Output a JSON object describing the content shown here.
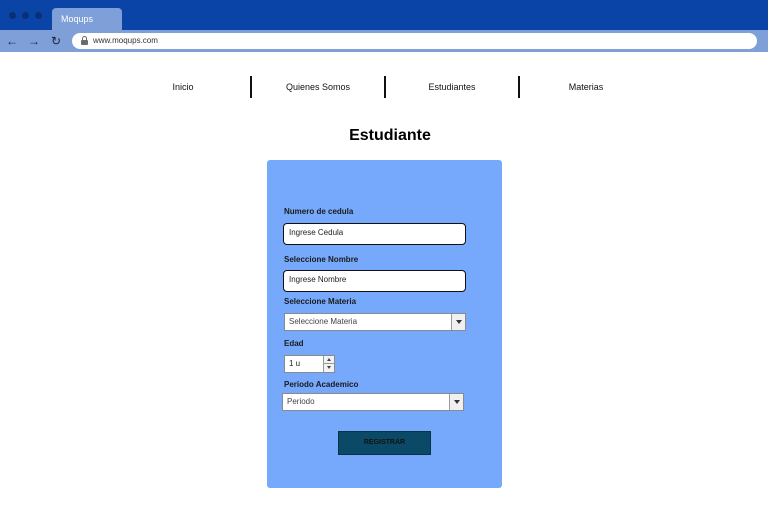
{
  "browser": {
    "tab_title": "Moqups",
    "url": "www.moqups.com",
    "colors": {
      "titlebar": "#0a44a7",
      "tab": "#7f9fd8",
      "addressbar": "#7f9fd8"
    }
  },
  "nav": {
    "items": [
      "Inicio",
      "Quienes Somos",
      "Estudiantes",
      "Materias"
    ]
  },
  "page": {
    "title": "Estudiante"
  },
  "form": {
    "card_color": "#76a9fb",
    "cedula": {
      "label": "Numero de cedula",
      "value": "Ingrese Cedula"
    },
    "nombre": {
      "label": "Seleccione Nombre",
      "value": "Ingrese Nombre"
    },
    "materia": {
      "label": "Seleccione Materia",
      "selected": "Seleccione Materia"
    },
    "edad": {
      "label": "Edad",
      "value": "1 u"
    },
    "periodo": {
      "label": "Periodo Academico",
      "selected": "Periodo"
    },
    "submit": {
      "label": "REGISTRAR",
      "color": "#0a4a66"
    }
  }
}
